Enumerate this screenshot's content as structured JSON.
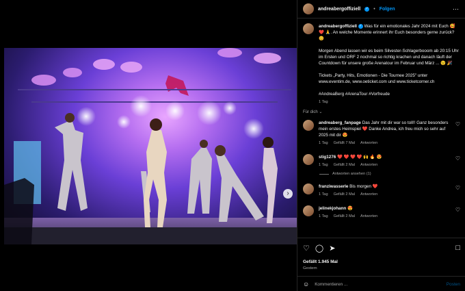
{
  "post": {
    "username": "andreabergoffiziell",
    "follow_label": "Folgen",
    "more_icon": "more-horizontal-icon",
    "caption_p1": "Was für ein emotionales Jahr 2024 mit Euch 🥰 ❤️ 🙏. An welche Momente erinnert ihr Euch besonders gerne zurück? 😊",
    "caption_p2": "Morgen Abend lassen wir es beim Silvester-Schlagerbooom ab 20:15 Uhr im Ersten und ORF 2 nochmal so richtig krachen und danach läuft der Countdown für unsere große Arenatour im Februar und März ... 😉 🎉",
    "caption_p3": "Tickets „Party, Hits, Emotionen - Die Tournee 2025\" unter www.eventim.de, www.oeticket.com und www.ticketcorner.ch",
    "caption_p4": "#AndreaBerg #ArenaTour #Vorfreude",
    "caption_time": "1 Tag",
    "for_you": "Für dich"
  },
  "comments": [
    {
      "user": "andreaberg_fanpage",
      "text": "Das Jahr mit dir war so toll!! Ganz besonders mein erstes Heimspiel ❤️ Danke Andrea, ich freu mich so sehr auf 2025 mit dir 😍",
      "time": "1 Tag",
      "likes": "Gefällt 7 Mal",
      "reply": "Antworten"
    },
    {
      "user": "stig1276",
      "text": "❤️ ❤️ ❤️ ❤️ 🙌 🔥 😍",
      "time": "1 Tag",
      "likes": "Gefällt 2 Mal",
      "reply": "Antworten",
      "view_replies": "Antworten ansehen (1)"
    },
    {
      "user": "franziwasserle",
      "text": "Bis morgen ❤️",
      "time": "1 Tag",
      "likes": "Gefällt 2 Mal",
      "reply": "Antworten"
    },
    {
      "user": "jelinekjohann",
      "text": "😍",
      "time": "1 Tag",
      "likes": "Gefällt 2 Mal",
      "reply": "Antworten"
    }
  ],
  "actions": {
    "like_icon": "heart-icon",
    "comment_icon": "comment-icon",
    "share_icon": "send-icon",
    "save_icon": "bookmark-icon",
    "likes_count": "Gefällt 1.945 Mal",
    "date": "Gestern",
    "comment_placeholder": "Kommentieren ...",
    "post_label": "Posten"
  },
  "colors": {
    "accent": "#0095f6",
    "background": "#000000",
    "muted_text": "#a8a8a8",
    "stage_purple": "#6a3fd6"
  }
}
